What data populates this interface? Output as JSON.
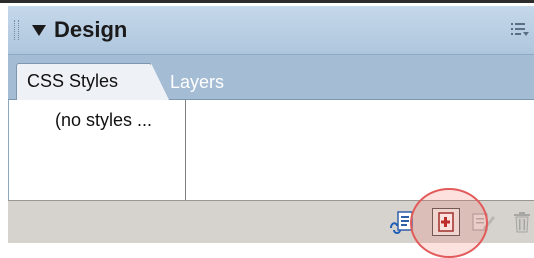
{
  "panel": {
    "title": "Design"
  },
  "tabs": [
    {
      "label": "CSS Styles",
      "active": true
    },
    {
      "label": "Layers",
      "active": false
    }
  ],
  "styles_list": {
    "placeholder": "(no styles ..."
  },
  "toolbar": {
    "buttons": [
      {
        "name": "attach-style-sheet",
        "icon": "attach-style-sheet-icon"
      },
      {
        "name": "new-css-rule",
        "icon": "new-css-rule-icon",
        "highlighted": true
      },
      {
        "name": "edit-style",
        "icon": "edit-style-icon",
        "disabled": true
      },
      {
        "name": "delete-css-rule",
        "icon": "trash-icon",
        "disabled": true
      }
    ]
  },
  "colors": {
    "titlebar": "#bdd1e4",
    "tabstrip": "#a4bcd4",
    "toolbar": "#d6d3ce",
    "highlight": "#e25a5a"
  }
}
